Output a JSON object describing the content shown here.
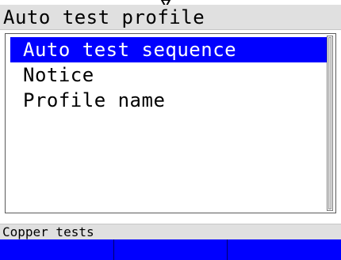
{
  "header": {
    "title": "Auto test profile"
  },
  "menu": {
    "items": [
      {
        "label": "Auto test sequence",
        "selected": true
      },
      {
        "label": "Notice",
        "selected": false
      },
      {
        "label": "Profile name",
        "selected": false
      }
    ]
  },
  "status": {
    "text": "Copper tests"
  },
  "softkeys": [
    {
      "label": ""
    },
    {
      "label": ""
    },
    {
      "label": ""
    }
  ],
  "colors": {
    "selection": "#0000ff",
    "softkey_bar": "#0000ff",
    "title_bar": "#e0e0e0",
    "status_bar": "#e0e0e0"
  },
  "icons": {
    "top_indicator": "down-arrow-icon"
  }
}
